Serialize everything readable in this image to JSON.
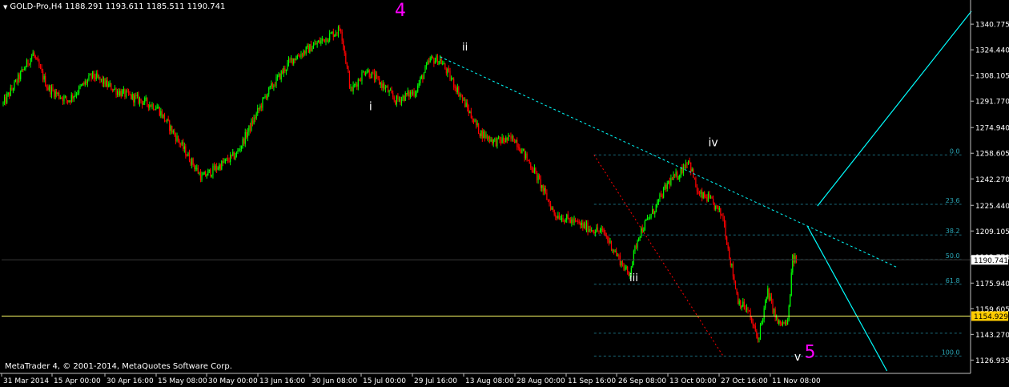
{
  "window": {
    "header_marker": "▼",
    "title": "GOLD-Pro,H4  1188.291 1193.611 1185.511 1190.741",
    "footer": "MetaTrader 4, © 2001-2014, MetaQuotes Software Corp."
  },
  "colors": {
    "background": "#000000",
    "bull_candle": "#00ff00",
    "bear_candle": "#ff0000",
    "text": "#ffffff",
    "wave_major": "#ff00ff",
    "trendline": "#00ffff",
    "fib_lines": "#1a6a7a",
    "fib_labels": "#2aa8b8",
    "fib_diagonal": "#ff0000",
    "current_price_line": "#ffffff",
    "horizontal_line": "#ffff66",
    "tag_bg": "#ffcc00"
  },
  "chart_data": {
    "type": "candlestick",
    "symbol": "GOLD-Pro",
    "timeframe": "H4",
    "ohlc_current": {
      "open": 1188.291,
      "high": 1193.611,
      "low": 1185.511,
      "close": 1190.741
    },
    "y_range": [
      1120.5,
      1349.0
    ],
    "y_ticks": [
      "1340.775",
      "1324.440",
      "1308.105",
      "1291.770",
      "1274.940",
      "1258.605",
      "1242.270",
      "1225.440",
      "1209.105",
      "1192.770",
      "1175.940",
      "1159.605",
      "1143.270",
      "1126.935"
    ],
    "x_labels": [
      "31 Mar 2014",
      "15 Apr 00:00",
      "30 Apr 16:00",
      "15 May 08:00",
      "30 May 00:00",
      "13 Jun 16:00",
      "30 Jun 08:00",
      "15 Jul 00:00",
      "29 Jul 16:00",
      "13 Aug 08:00",
      "28 Aug 00:00",
      "11 Sep 16:00",
      "26 Sep 08:00",
      "13 Oct 00:00",
      "27 Oct 16:00",
      "11 Nov 08:00"
    ],
    "price_path_anchors": [
      [
        0,
        1290
      ],
      [
        6,
        1322
      ],
      [
        9,
        1300
      ],
      [
        13,
        1292
      ],
      [
        18,
        1308
      ],
      [
        23,
        1298
      ],
      [
        31,
        1288
      ],
      [
        40,
        1243
      ],
      [
        47,
        1258
      ],
      [
        53,
        1296
      ],
      [
        58,
        1318
      ],
      [
        63,
        1328
      ],
      [
        68,
        1338
      ],
      [
        70,
        1298
      ],
      [
        73,
        1312
      ],
      [
        77,
        1300
      ],
      [
        79,
        1292
      ],
      [
        83,
        1298
      ],
      [
        86,
        1318
      ],
      [
        88,
        1318
      ],
      [
        92,
        1296
      ],
      [
        96,
        1272
      ],
      [
        99,
        1266
      ],
      [
        103,
        1268
      ],
      [
        107,
        1247
      ],
      [
        111,
        1220
      ],
      [
        117,
        1212
      ],
      [
        121,
        1208
      ],
      [
        123,
        1197
      ],
      [
        126,
        1181
      ],
      [
        128,
        1207
      ],
      [
        131,
        1222
      ],
      [
        134,
        1240
      ],
      [
        136,
        1245
      ],
      [
        138,
        1255
      ],
      [
        140,
        1232
      ],
      [
        142,
        1230
      ],
      [
        145,
        1218
      ],
      [
        146,
        1198
      ],
      [
        148,
        1165
      ],
      [
        150,
        1158
      ],
      [
        152,
        1140
      ],
      [
        154,
        1170
      ],
      [
        156,
        1150
      ],
      [
        158,
        1150
      ],
      [
        159,
        1191
      ]
    ],
    "current_price": {
      "value": 1190.741,
      "label": "1190.741"
    },
    "horizontal_line": {
      "value": 1154.929,
      "label": "1154.929"
    },
    "trendline_upper": {
      "points": [
        [
          88,
          1320
        ],
        [
          180,
          1186
        ]
      ]
    },
    "channel_lines": [
      {
        "points": [
          [
            164,
            1225
          ],
          [
            195,
            1349
          ]
        ]
      },
      {
        "points": [
          [
            162,
            1212
          ],
          [
            178,
            1120
          ]
        ]
      }
    ],
    "fibonacci": {
      "x_start": 119,
      "x_end": 193,
      "diagonal_end": 145,
      "levels": [
        {
          "label": "0.0",
          "value": 1257.5
        },
        {
          "label": "23.6",
          "value": 1226.1
        },
        {
          "label": "38.2",
          "value": 1206.6
        },
        {
          "label": "50.0",
          "value": 1190.9
        },
        {
          "label": "61.8",
          "value": 1175.2
        },
        {
          "label": "",
          "value": 1144.0
        },
        {
          "label": "100.0",
          "value": 1129.5
        }
      ]
    },
    "wave_labels": [
      {
        "text": "4",
        "bar": 80,
        "value": 1346,
        "color": "wave_major",
        "size": 22
      },
      {
        "text": "i",
        "bar": 74,
        "value": 1286,
        "color": "text",
        "size": 14
      },
      {
        "text": "ii",
        "bar": 93,
        "value": 1324,
        "color": "text",
        "size": 13
      },
      {
        "text": "iii",
        "bar": 127,
        "value": 1177,
        "color": "text",
        "size": 13
      },
      {
        "text": "iv",
        "bar": 143,
        "value": 1263,
        "color": "text",
        "size": 14
      },
      {
        "text": "v",
        "bar": 160,
        "value": 1126.5,
        "color": "text",
        "size": 14
      },
      {
        "text": "5",
        "bar": 162.5,
        "value": 1128.5,
        "color": "wave_major",
        "size": 22
      }
    ]
  }
}
